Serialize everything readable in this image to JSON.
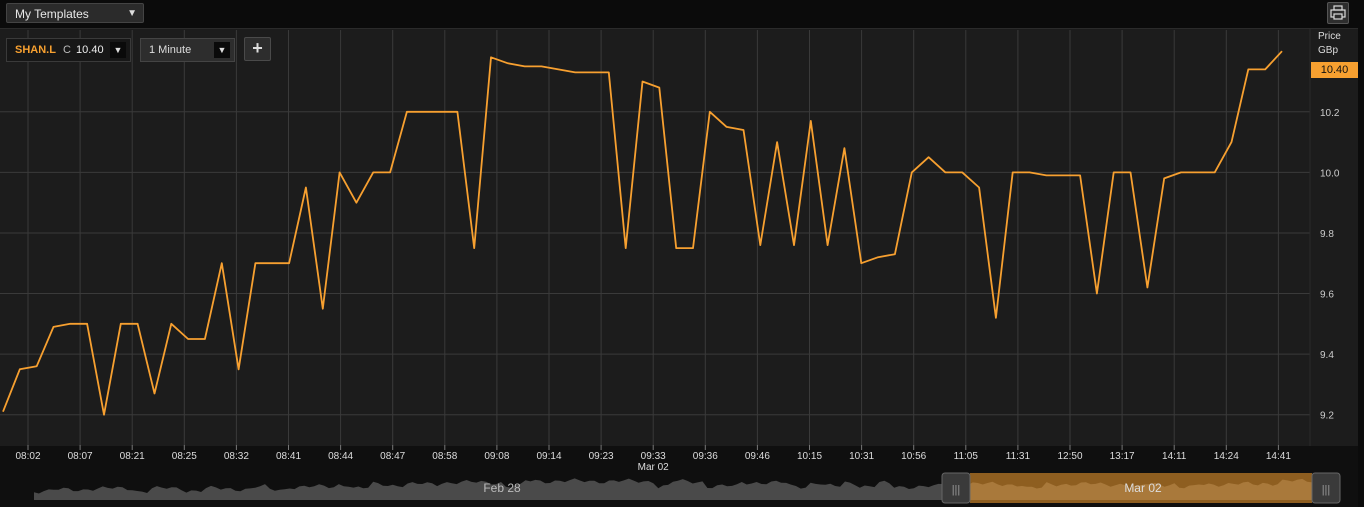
{
  "toolbar": {
    "template_select": "My Templates",
    "print_icon": "printer-icon"
  },
  "instrument": {
    "ric": "SHAN.L",
    "close_label": "C",
    "close_value": "10.40",
    "interval": "1 Minute",
    "add_label": "+"
  },
  "axis": {
    "price_title": "Price",
    "currency": "GBp",
    "last_price": "10.40"
  },
  "navigator": {
    "left_label": "Feb 28",
    "right_label": "Mar 02"
  },
  "colors": {
    "line": "#f7a030",
    "background": "#1c1c1c",
    "grid": "#3a3a3a"
  },
  "chart_data": {
    "type": "line",
    "title": "",
    "xlabel": "",
    "ylabel": "Price GBp",
    "ylim": [
      9.1,
      10.47
    ],
    "yticks": [
      9.2,
      9.4,
      9.6,
      9.8,
      10.0,
      10.2
    ],
    "grid": true,
    "x_tick_labels": [
      "08:02",
      "08:07",
      "08:21",
      "08:25",
      "08:32",
      "08:41",
      "08:44",
      "08:47",
      "08:58",
      "09:08",
      "09:14",
      "09:23",
      "09:33",
      "09:36",
      "09:46",
      "10:15",
      "10:31",
      "10:56",
      "11:05",
      "11:31",
      "12:50",
      "13:17",
      "14:11",
      "14:24",
      "14:41"
    ],
    "x_sublabel": {
      "under": "09:33",
      "text": "Mar 02"
    },
    "series": [
      {
        "values": [
          9.21,
          9.35,
          9.36,
          9.49,
          9.5,
          9.5,
          9.2,
          9.5,
          9.5,
          9.27,
          9.5,
          9.45,
          9.45,
          9.7,
          9.35,
          9.7,
          9.7,
          9.7,
          9.95,
          9.55,
          10.0,
          9.9,
          10.0,
          10.0,
          10.2,
          10.2,
          10.2,
          10.2,
          9.75,
          10.38,
          10.36,
          10.35,
          10.35,
          10.34,
          10.33,
          10.33,
          10.33,
          9.75,
          10.3,
          10.28,
          9.75,
          9.75,
          10.2,
          10.15,
          10.14,
          9.76,
          10.1,
          9.76,
          10.17,
          9.76,
          10.08,
          9.7,
          9.72,
          9.73,
          10.0,
          10.05,
          10.0,
          10.0,
          9.95,
          9.52,
          10.0,
          10.0,
          9.99,
          9.99,
          9.99,
          9.6,
          10.0,
          10.0,
          9.62,
          9.98,
          10.0,
          10.0,
          10.0,
          10.1,
          10.34,
          10.34,
          10.4
        ]
      }
    ]
  }
}
